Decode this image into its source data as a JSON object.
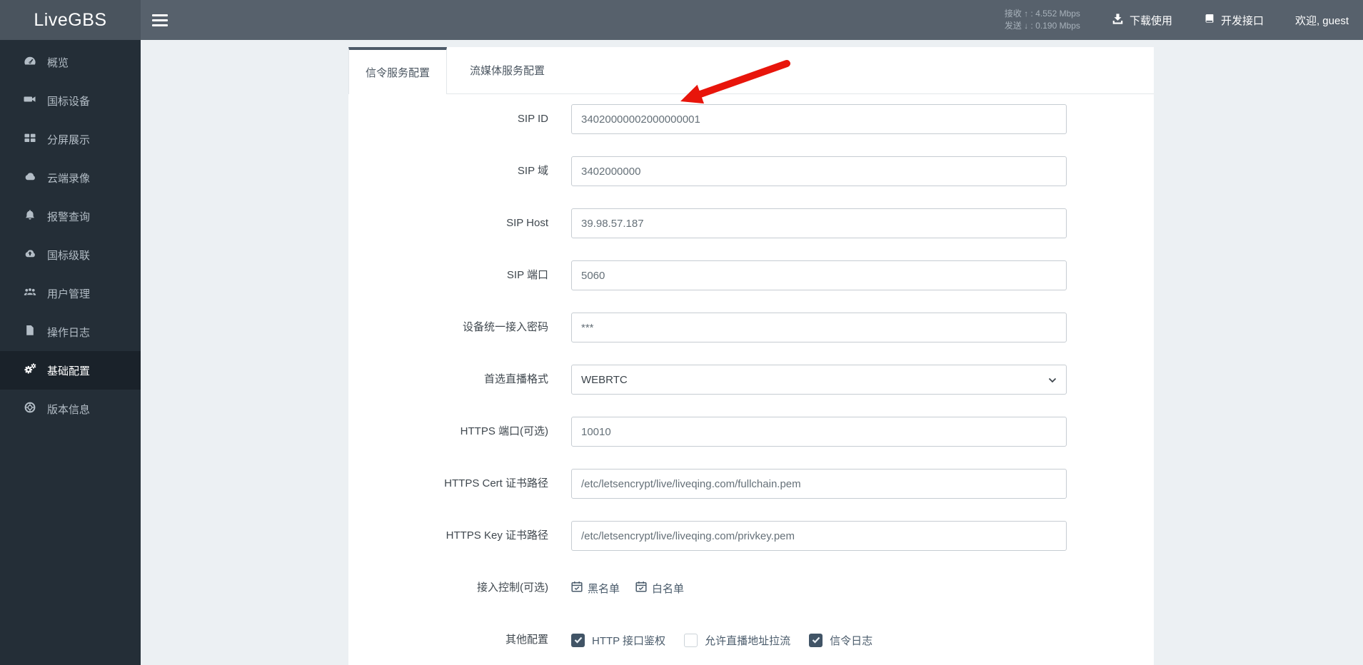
{
  "app": {
    "name": "LiveGBS"
  },
  "header": {
    "stats": {
      "rx_label": "接收",
      "rx_arrow": "↑",
      "rx_sep": " :  ",
      "rx_value": "4.552 Mbps",
      "tx_label": "发送",
      "tx_arrow": "↓",
      "tx_sep": " :  ",
      "tx_value": "0.190 Mbps"
    },
    "download_label": "下载使用",
    "api_label": "开发接口",
    "welcome": "欢迎, guest"
  },
  "sidebar": {
    "items": [
      {
        "label": "概览",
        "icon": "gauge-icon",
        "active": false
      },
      {
        "label": "国标设备",
        "icon": "video-camera-icon",
        "active": false
      },
      {
        "label": "分屏展示",
        "icon": "grid-icon",
        "active": false
      },
      {
        "label": "云端录像",
        "icon": "cloud-icon",
        "active": false
      },
      {
        "label": "报警查询",
        "icon": "bell-icon",
        "active": false
      },
      {
        "label": "国标级联",
        "icon": "cloud-upload-icon",
        "active": false
      },
      {
        "label": "用户管理",
        "icon": "users-icon",
        "active": false
      },
      {
        "label": "操作日志",
        "icon": "file-icon",
        "active": false
      },
      {
        "label": "基础配置",
        "icon": "gears-icon",
        "active": true
      },
      {
        "label": "版本信息",
        "icon": "ring-icon",
        "active": false
      }
    ]
  },
  "main": {
    "tabs": [
      {
        "label": "信令服务配置",
        "active": true
      },
      {
        "label": "流媒体服务配置",
        "active": false
      }
    ],
    "form": {
      "fields": [
        {
          "label": "SIP ID",
          "value": "34020000002000000001",
          "control": "input"
        },
        {
          "label": "SIP 域",
          "value": "3402000000",
          "control": "input"
        },
        {
          "label": "SIP Host",
          "value": "39.98.57.187",
          "control": "input"
        },
        {
          "label": "SIP 端口",
          "value": "5060",
          "control": "input"
        },
        {
          "label": "设备统一接入密码",
          "value": "***",
          "control": "input"
        },
        {
          "label": "首选直播格式",
          "value": "WEBRTC",
          "control": "select"
        },
        {
          "label": "HTTPS 端口(可选)",
          "value": "10010",
          "control": "input"
        },
        {
          "label": "HTTPS Cert 证书路径",
          "value": "/etc/letsencrypt/live/liveqing.com/fullchain.pem",
          "control": "input"
        },
        {
          "label": "HTTPS Key 证书路径",
          "value": "/etc/letsencrypt/live/liveqing.com/privkey.pem",
          "control": "input"
        }
      ],
      "access_control": {
        "label": "接入控制(可选)",
        "blacklist": "黑名单",
        "whitelist": "白名单"
      },
      "other_config": {
        "label": "其他配置",
        "options": [
          {
            "label": "HTTP 接口鉴权",
            "checked": true
          },
          {
            "label": "允许直播地址拉流",
            "checked": false
          },
          {
            "label": "信令日志",
            "checked": true
          }
        ]
      }
    }
  },
  "annotation": {
    "shape": "red-arrow",
    "color": "#e8150b"
  },
  "colors": {
    "header_bg": "#57616c",
    "logo_bg": "#4a545e",
    "sidebar_bg": "#242e37",
    "sidebar_active_bg": "#1a222a",
    "page_bg": "#ecf0f3",
    "tab_accent": "#4d5a68",
    "checkbox_checked": "#415466",
    "slate_link": "#4a5b6b",
    "arrow_red": "#e8150b"
  }
}
